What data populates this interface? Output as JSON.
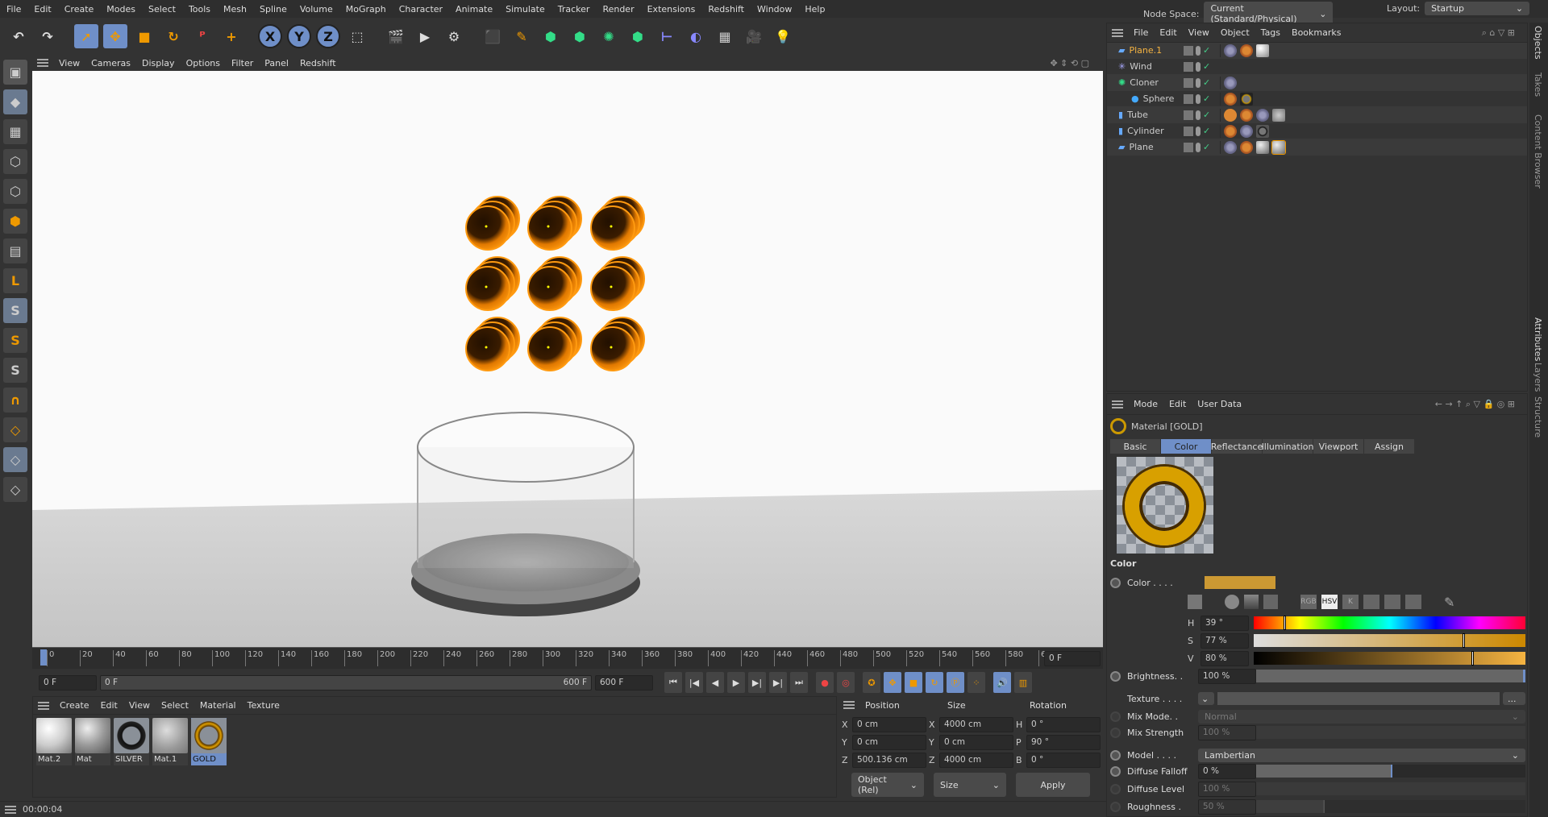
{
  "menu": [
    "File",
    "Edit",
    "Create",
    "Modes",
    "Select",
    "Tools",
    "Mesh",
    "Spline",
    "Volume",
    "MoGraph",
    "Character",
    "Animate",
    "Simulate",
    "Tracker",
    "Render",
    "Extensions",
    "Redshift",
    "Window",
    "Help"
  ],
  "node_space": {
    "label": "Node Space:",
    "value": "Current (Standard/Physical)"
  },
  "layout": {
    "label": "Layout:",
    "value": "Startup"
  },
  "toolbar_icons": [
    "undo-icon",
    "redo-icon",
    "select-icon",
    "move-icon",
    "scale-icon",
    "rotate-icon",
    "recent-tool-icon",
    "add-icon",
    "x-axis-icon",
    "y-axis-icon",
    "z-axis-icon",
    "coordinate-system-icon",
    "render-view-icon",
    "render-picture-queue-icon",
    "render-settings-icon",
    "cube-icon",
    "pen-icon",
    "subdivision-icon",
    "extrude-icon",
    "cloner-icon",
    "array-icon",
    "deformer-icon",
    "sky-icon",
    "floor-icon",
    "camera-icon",
    "light-icon"
  ],
  "toolbar_labels": {
    "x": "X",
    "y": "Y",
    "z": "Z"
  },
  "viewport_menu": [
    "View",
    "Cameras",
    "Display",
    "Options",
    "Filter",
    "Panel",
    "Redshift"
  ],
  "timeline": {
    "ticks": [
      "0",
      "20",
      "40",
      "60",
      "80",
      "100",
      "120",
      "140",
      "160",
      "180",
      "200",
      "220",
      "240",
      "260",
      "280",
      "300",
      "320",
      "340",
      "360",
      "380",
      "400",
      "420",
      "440",
      "460",
      "480",
      "500",
      "520",
      "540",
      "560",
      "580",
      "600"
    ],
    "current": "0 F",
    "start": "0 F",
    "range_start": "0 F",
    "range_end": "600 F",
    "end": "600 F"
  },
  "material_menu": [
    "Create",
    "Edit",
    "View",
    "Select",
    "Material",
    "Texture"
  ],
  "materials": [
    {
      "name": "Mat.2",
      "style": "white"
    },
    {
      "name": "Mat",
      "style": "grey"
    },
    {
      "name": "SILVER",
      "style": "ring-black"
    },
    {
      "name": "Mat.1",
      "style": "glass"
    },
    {
      "name": "GOLD",
      "style": "ring-gold",
      "selected": true
    }
  ],
  "coords": {
    "headers": [
      "Position",
      "Size",
      "Rotation"
    ],
    "rows": [
      {
        "a": "X",
        "pos": "0 cm",
        "b": "X",
        "size": "4000 cm",
        "c": "H",
        "rot": "0 °"
      },
      {
        "a": "Y",
        "pos": "0 cm",
        "b": "Y",
        "size": "0 cm",
        "c": "P",
        "rot": "90 °"
      },
      {
        "a": "Z",
        "pos": "500.136 cm",
        "b": "Z",
        "size": "4000 cm",
        "c": "B",
        "rot": "0 °"
      }
    ],
    "mode": "Object (Rel)",
    "size_mode": "Size",
    "apply": "Apply"
  },
  "status": "00:00:04",
  "objects_menu": [
    "File",
    "Edit",
    "View",
    "Object",
    "Tags",
    "Bookmarks"
  ],
  "objects": [
    {
      "name": "Plane.1",
      "icon": "plane-icon",
      "active": true,
      "tags": [
        "mograph-tag",
        "material-tag",
        "material-white"
      ]
    },
    {
      "name": "Wind",
      "icon": "wind-icon",
      "tags": []
    },
    {
      "name": "Cloner",
      "icon": "cloner-icon",
      "tags": [
        "mograph-tag"
      ]
    },
    {
      "name": "Sphere",
      "icon": "sphere-icon",
      "child": true,
      "tags": [
        "material-tag",
        "material-gold"
      ]
    },
    {
      "name": "Tube",
      "icon": "tube-icon",
      "tags": [
        "render-tag",
        "material-tag",
        "mograph-tag",
        "material-glass"
      ]
    },
    {
      "name": "Cylinder",
      "icon": "cylinder-icon",
      "tags": [
        "material-tag",
        "mograph-tag",
        "material-silver"
      ]
    },
    {
      "name": "Plane",
      "icon": "plane-icon",
      "tags": [
        "mograph-tag",
        "material-tag",
        "material-grey",
        "material-grey-selected"
      ]
    }
  ],
  "attr_menu": [
    "Mode",
    "Edit",
    "User Data"
  ],
  "attr_title": "Material [GOLD]",
  "attr_tabs": [
    "Basic",
    "Color",
    "Reflectance",
    "Illumination",
    "Viewport",
    "Assign"
  ],
  "attr_active_tab": "Color",
  "section": "Color",
  "color": {
    "label": "Color . . . .",
    "swatch": "#cc9933",
    "modes": [
      "RGB",
      "HSV",
      "K"
    ],
    "active_mode": "HSV"
  },
  "hsv": {
    "h_label": "H",
    "h": "39 °",
    "h_value": 39,
    "s_label": "S",
    "s": "77 %",
    "s_value": 77,
    "v_label": "V",
    "v": "80 %",
    "v_value": 80
  },
  "brightness": {
    "label": "Brightness. .",
    "value": "100 %"
  },
  "texture": {
    "label": "Texture . . . .",
    "more": "..."
  },
  "mix_mode": {
    "label": "Mix Mode. .",
    "value": "Normal"
  },
  "mix_strength": {
    "label": "Mix Strength",
    "value": "100 %"
  },
  "model": {
    "label": "Model . . . .",
    "value": "Lambertian"
  },
  "diffuse_falloff": {
    "label": "Diffuse Falloff",
    "value": "0 %"
  },
  "diffuse_level": {
    "label": "Diffuse Level",
    "value": "100 %"
  },
  "roughness": {
    "label": "Roughness .",
    "value": "50 %"
  },
  "side_tabs": [
    "Objects",
    "Takes",
    "Content Browser",
    "Attributes",
    "Layers",
    "Structure"
  ]
}
